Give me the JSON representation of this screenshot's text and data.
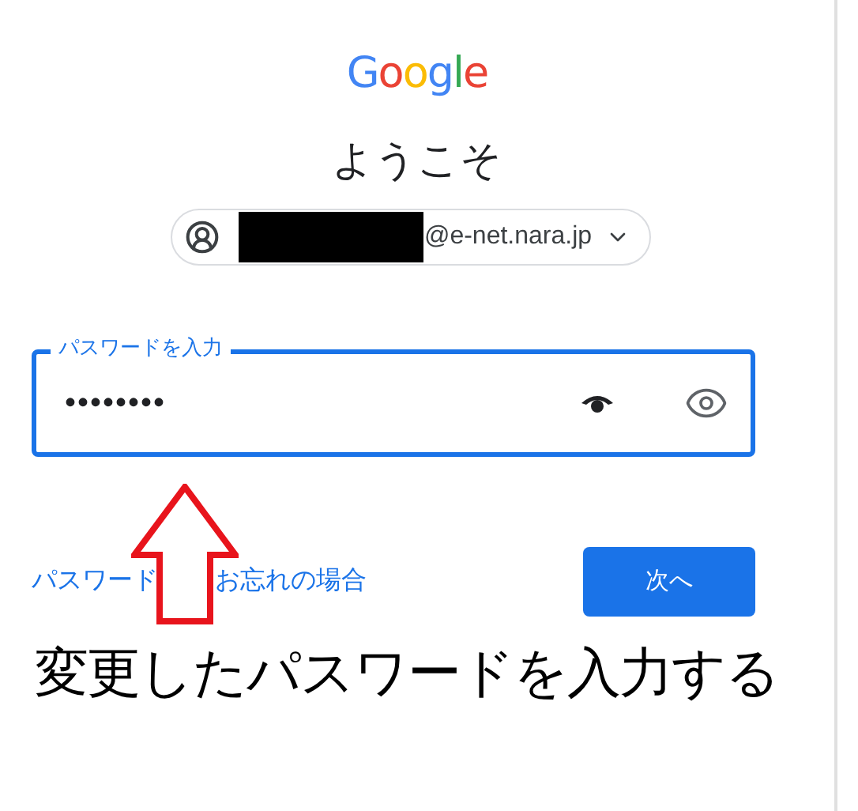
{
  "logo": "Google",
  "title": "ようこそ",
  "account": {
    "email_suffix": "@e-net.nara.jp",
    "redacted": true
  },
  "password_field": {
    "label": "パスワードを入力",
    "value": "••••••••"
  },
  "forgot_link": {
    "visible_parts": [
      "パスワード",
      "お忘れの場合"
    ]
  },
  "next_button": "次へ",
  "annotation": {
    "caption": "変更したパスワードを入力する"
  }
}
